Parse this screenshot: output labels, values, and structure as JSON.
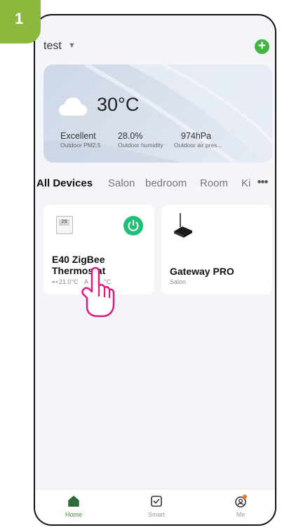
{
  "step_badge": "1",
  "header": {
    "home_name": "test"
  },
  "weather": {
    "temperature": "30°C",
    "metrics": [
      {
        "value": "Excellent",
        "label": "Outdoor PM2.5"
      },
      {
        "value": "28.0%",
        "label": "Outdoor humidity"
      },
      {
        "value": "974hPa",
        "label": "Outdoor air pres..."
      }
    ]
  },
  "tabs": [
    "All Devices",
    "Salon",
    "bedroom",
    "Room",
    "Ki"
  ],
  "devices": [
    {
      "name_line1": "E40 ZigBee",
      "name_line2": "Thermostat",
      "status": "21.0°C",
      "status_extra": "A",
      "status_tail": "°C",
      "power": "on",
      "thermo_display": "28"
    },
    {
      "name": "Gateway PRO",
      "room": "Salon"
    }
  ],
  "bottom_nav": [
    {
      "label": "Home",
      "active": true
    },
    {
      "label": "Smart",
      "active": false
    },
    {
      "label": "Me",
      "active": false,
      "badge": true
    }
  ],
  "colors": {
    "accent_green": "#42b543",
    "power_green": "#1fbf7a",
    "badge_green": "#8bb83d",
    "hand_pink": "#e0197d",
    "notify_orange": "#ff7a1a"
  },
  "icons": [
    "cloud-icon",
    "add-icon",
    "more-icon",
    "power-icon",
    "home-icon",
    "smart-icon",
    "me-icon",
    "pointing-hand-icon"
  ]
}
